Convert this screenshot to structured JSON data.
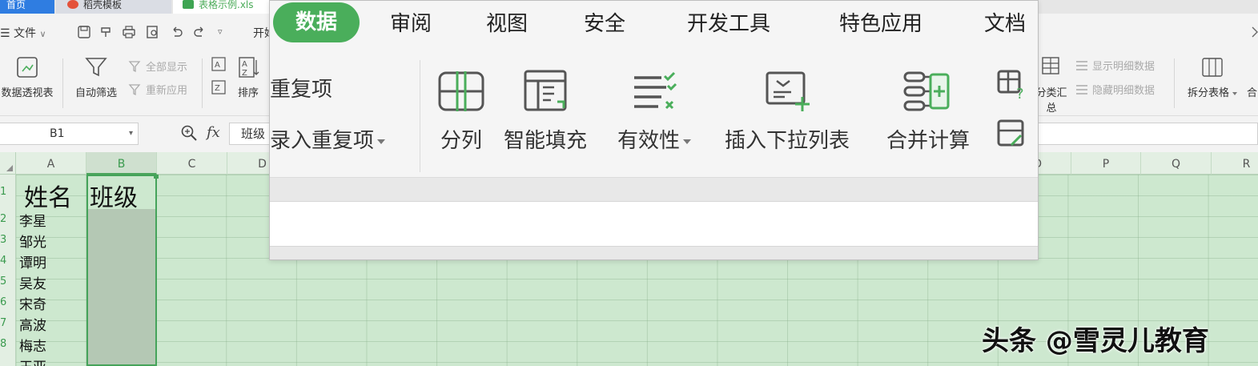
{
  "tabs": {
    "home": "首页",
    "templates": "稻壳模板",
    "file": "表格示例.xls"
  },
  "quickbar": {
    "menu_label": "文件",
    "cut_label": "开始"
  },
  "ribbon": {
    "pivot": "数据透视表",
    "autofilter": "自动筛选",
    "show_all": "全部显示",
    "reapply": "重新应用",
    "sort": "排序",
    "subtotal": "分类汇总",
    "show_detail": "显示明细数据",
    "hide_detail": "隐藏明细数据",
    "split_table": "拆分表格",
    "merge": "合"
  },
  "formula_bar": {
    "name_box": "B1",
    "fx": "fx",
    "content": "班级"
  },
  "sheet": {
    "columns": [
      "A",
      "B",
      "C",
      "D",
      "O",
      "P",
      "Q",
      "R"
    ],
    "rows": [
      "1",
      "2",
      "3",
      "4",
      "5",
      "6",
      "7",
      "8"
    ],
    "header_a": "姓名",
    "header_b": "班级",
    "names": [
      "李星",
      "邹光",
      "谭明",
      "吴友",
      "宋奇",
      "高波",
      "梅志",
      "王亚"
    ]
  },
  "overlay": {
    "tabs": [
      "数据",
      "审阅",
      "视图",
      "安全",
      "开发工具",
      "特色应用",
      "文档"
    ],
    "duplicates": "重复项",
    "refuse_duplicates": "录入重复项",
    "split_column": "分列",
    "smart_fill": "智能填充",
    "validity": "有效性",
    "insert_dropdown": "插入下拉列表",
    "consolidate": "合并计算"
  },
  "watermark": "头条 @雪灵儿教育",
  "colors": {
    "accent_green": "#4aae5b",
    "sheet_bg": "#cde8cf",
    "home_tab_blue": "#2f7de1"
  }
}
